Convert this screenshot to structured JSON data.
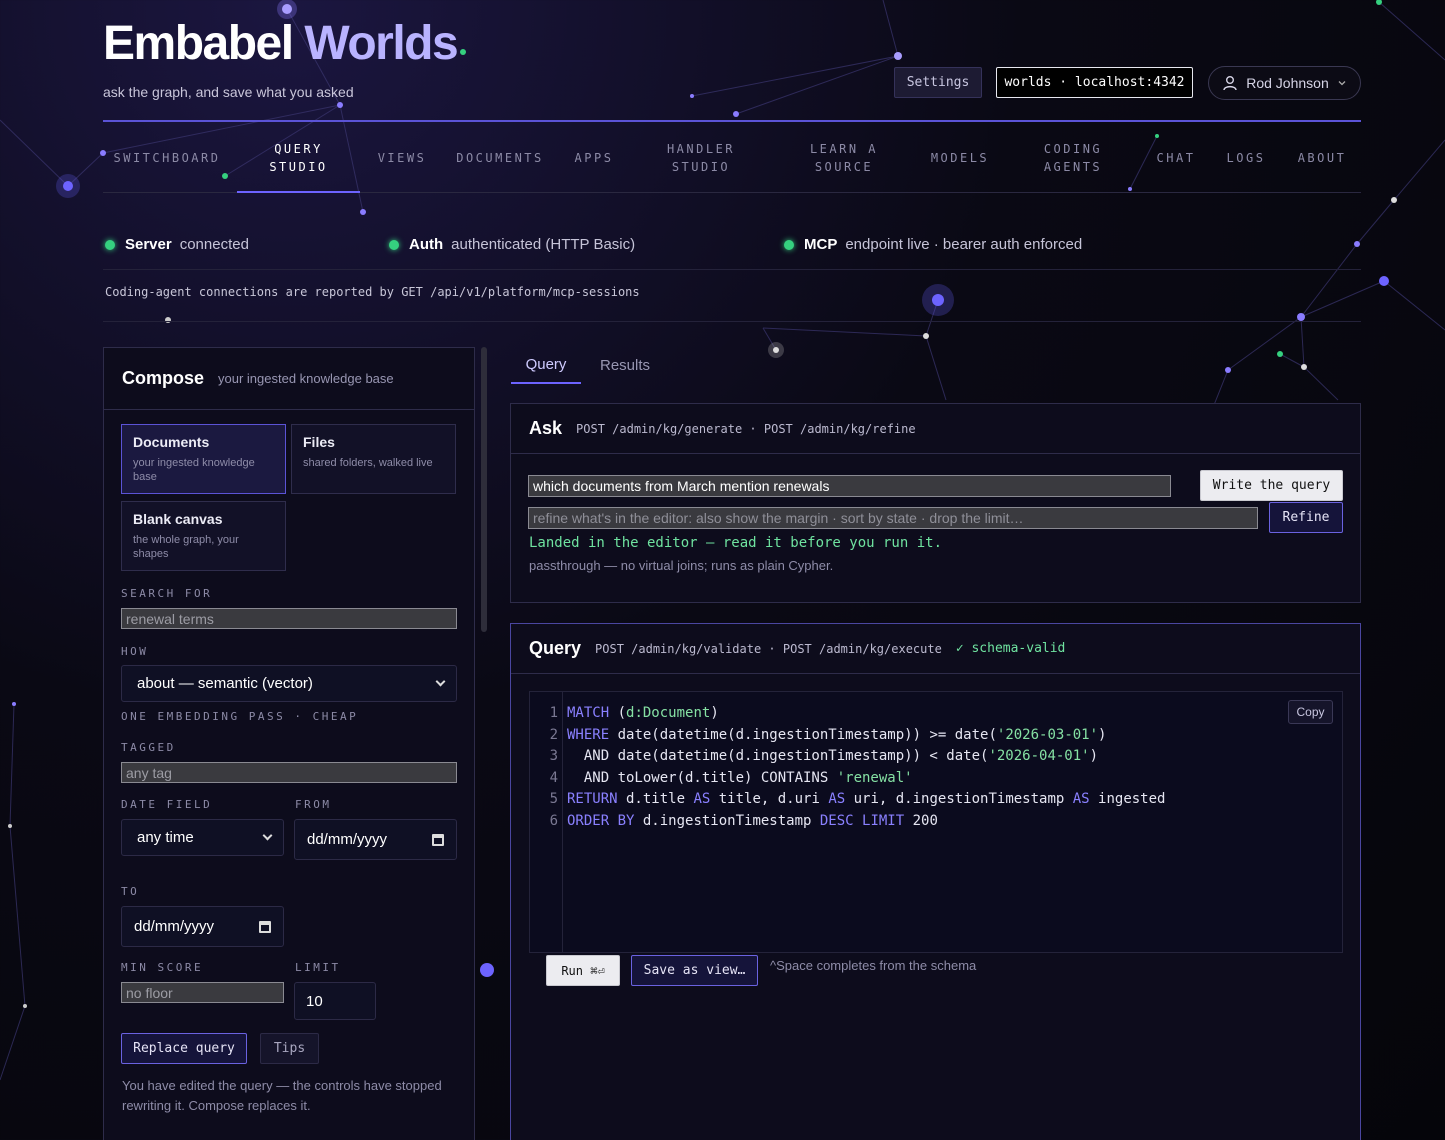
{
  "brand": {
    "title_main": "Embabel ",
    "title_accent": "Worlds",
    "tagline": "ask the graph, and save what you asked"
  },
  "header": {
    "settings_label": "Settings",
    "host_label": "worlds · localhost:4342",
    "user_name": "Rod Johnson"
  },
  "nav": [
    {
      "label": "SWITCHBOARD",
      "active": false
    },
    {
      "label": "QUERY STUDIO",
      "active": true
    },
    {
      "label": "VIEWS",
      "active": false
    },
    {
      "label": "DOCUMENTS",
      "active": false
    },
    {
      "label": "APPS",
      "active": false
    },
    {
      "label": "HANDLER STUDIO",
      "active": false
    },
    {
      "label": "LEARN A SOURCE",
      "active": false
    },
    {
      "label": "MODELS",
      "active": false
    },
    {
      "label": "CODING AGENTS",
      "active": false
    },
    {
      "label": "CHAT",
      "active": false
    },
    {
      "label": "LOGS",
      "active": false
    },
    {
      "label": "ABOUT",
      "active": false
    }
  ],
  "status": [
    {
      "name": "Server",
      "value": "connected",
      "color": "#35d07f"
    },
    {
      "name": "Auth",
      "value": "authenticated (HTTP Basic)",
      "color": "#35d07f"
    },
    {
      "name": "MCP",
      "value": "endpoint live · bearer auth enforced",
      "color": "#35d07f"
    }
  ],
  "connections_note": "Coding-agent connections are reported by GET /api/v1/platform/mcp-sessions",
  "compose": {
    "title": "Compose",
    "subtitle": "your ingested knowledge base",
    "sources": [
      {
        "name": "Documents",
        "desc": "your ingested knowledge base",
        "selected": true
      },
      {
        "name": "Files",
        "desc": "shared folders, walked live",
        "selected": false
      },
      {
        "name": "Blank canvas",
        "desc": "the whole graph, your shapes",
        "selected": false
      }
    ],
    "search_label": "SEARCH FOR",
    "search_placeholder": "renewal terms",
    "how_label": "HOW",
    "how_value": "about — semantic (vector)",
    "how_hint": "ONE EMBEDDING PASS · CHEAP",
    "tagged_label": "TAGGED",
    "tagged_placeholder": "any tag",
    "date_field_label": "DATE FIELD",
    "date_field_value": "any time",
    "from_label": "FROM",
    "from_value": "dd/mm/yyyy",
    "to_label": "TO",
    "to_value": "dd/mm/yyyy",
    "min_score_label": "MIN SCORE",
    "min_score_placeholder": "no floor",
    "limit_label": "LIMIT",
    "limit_value": "10",
    "replace_label": "Replace query",
    "tips_label": "Tips",
    "note": "You have edited the query — the controls have stopped rewriting it. Compose replaces it."
  },
  "tabs": [
    {
      "label": "Query",
      "active": true
    },
    {
      "label": "Results",
      "active": false
    }
  ],
  "ask": {
    "title": "Ask",
    "endpoints": "POST /admin/kg/generate · POST /admin/kg/refine",
    "question_value": "which documents from March mention renewals",
    "write_label": "Write the query",
    "refine_placeholder": "refine what's in the editor: also show the margin · sort by state · drop the limit…",
    "refine_label": "Refine",
    "status_text": "Landed in the editor — read it before you run it.",
    "mode_text": "passthrough — no virtual joins; runs as plain Cypher."
  },
  "query": {
    "title": "Query",
    "endpoints": "POST /admin/kg/validate · POST /admin/kg/execute",
    "validity": "✓ schema-valid",
    "copy_label": "Copy",
    "line_numbers": [
      "1",
      "2",
      "3",
      "4",
      "5",
      "6"
    ],
    "lines": [
      [
        {
          "t": "MATCH",
          "k": "kw"
        },
        {
          "t": " ("
        },
        {
          "t": "d:Document",
          "k": "str"
        },
        {
          "t": ")"
        }
      ],
      [
        {
          "t": "WHERE",
          "k": "kw"
        },
        {
          "t": " date(datetime(d.ingestionTimestamp)) >= date("
        },
        {
          "t": "'2026-03-01'",
          "k": "str"
        },
        {
          "t": ")"
        }
      ],
      [
        {
          "t": "  AND date(datetime(d.ingestionTimestamp)) < date("
        },
        {
          "t": "'2026-04-01'",
          "k": "str"
        },
        {
          "t": ")"
        }
      ],
      [
        {
          "t": "  AND toLower(d.title) CONTAINS "
        },
        {
          "t": "'renewal'",
          "k": "str"
        }
      ],
      [
        {
          "t": "RETURN",
          "k": "kw"
        },
        {
          "t": " d.title "
        },
        {
          "t": "AS",
          "k": "kw"
        },
        {
          "t": " title, d.uri "
        },
        {
          "t": "AS",
          "k": "kw"
        },
        {
          "t": " uri, d.ingestionTimestamp "
        },
        {
          "t": "AS",
          "k": "kw"
        },
        {
          "t": " ingested"
        }
      ],
      [
        {
          "t": "ORDER BY",
          "k": "kw"
        },
        {
          "t": " d.ingestionTimestamp "
        },
        {
          "t": "DESC LIMIT",
          "k": "kw"
        },
        {
          "t": " 200"
        }
      ]
    ],
    "run_label": "Run ⌘⏎",
    "save_label": "Save as view…",
    "hint": "^Space completes from the schema"
  }
}
